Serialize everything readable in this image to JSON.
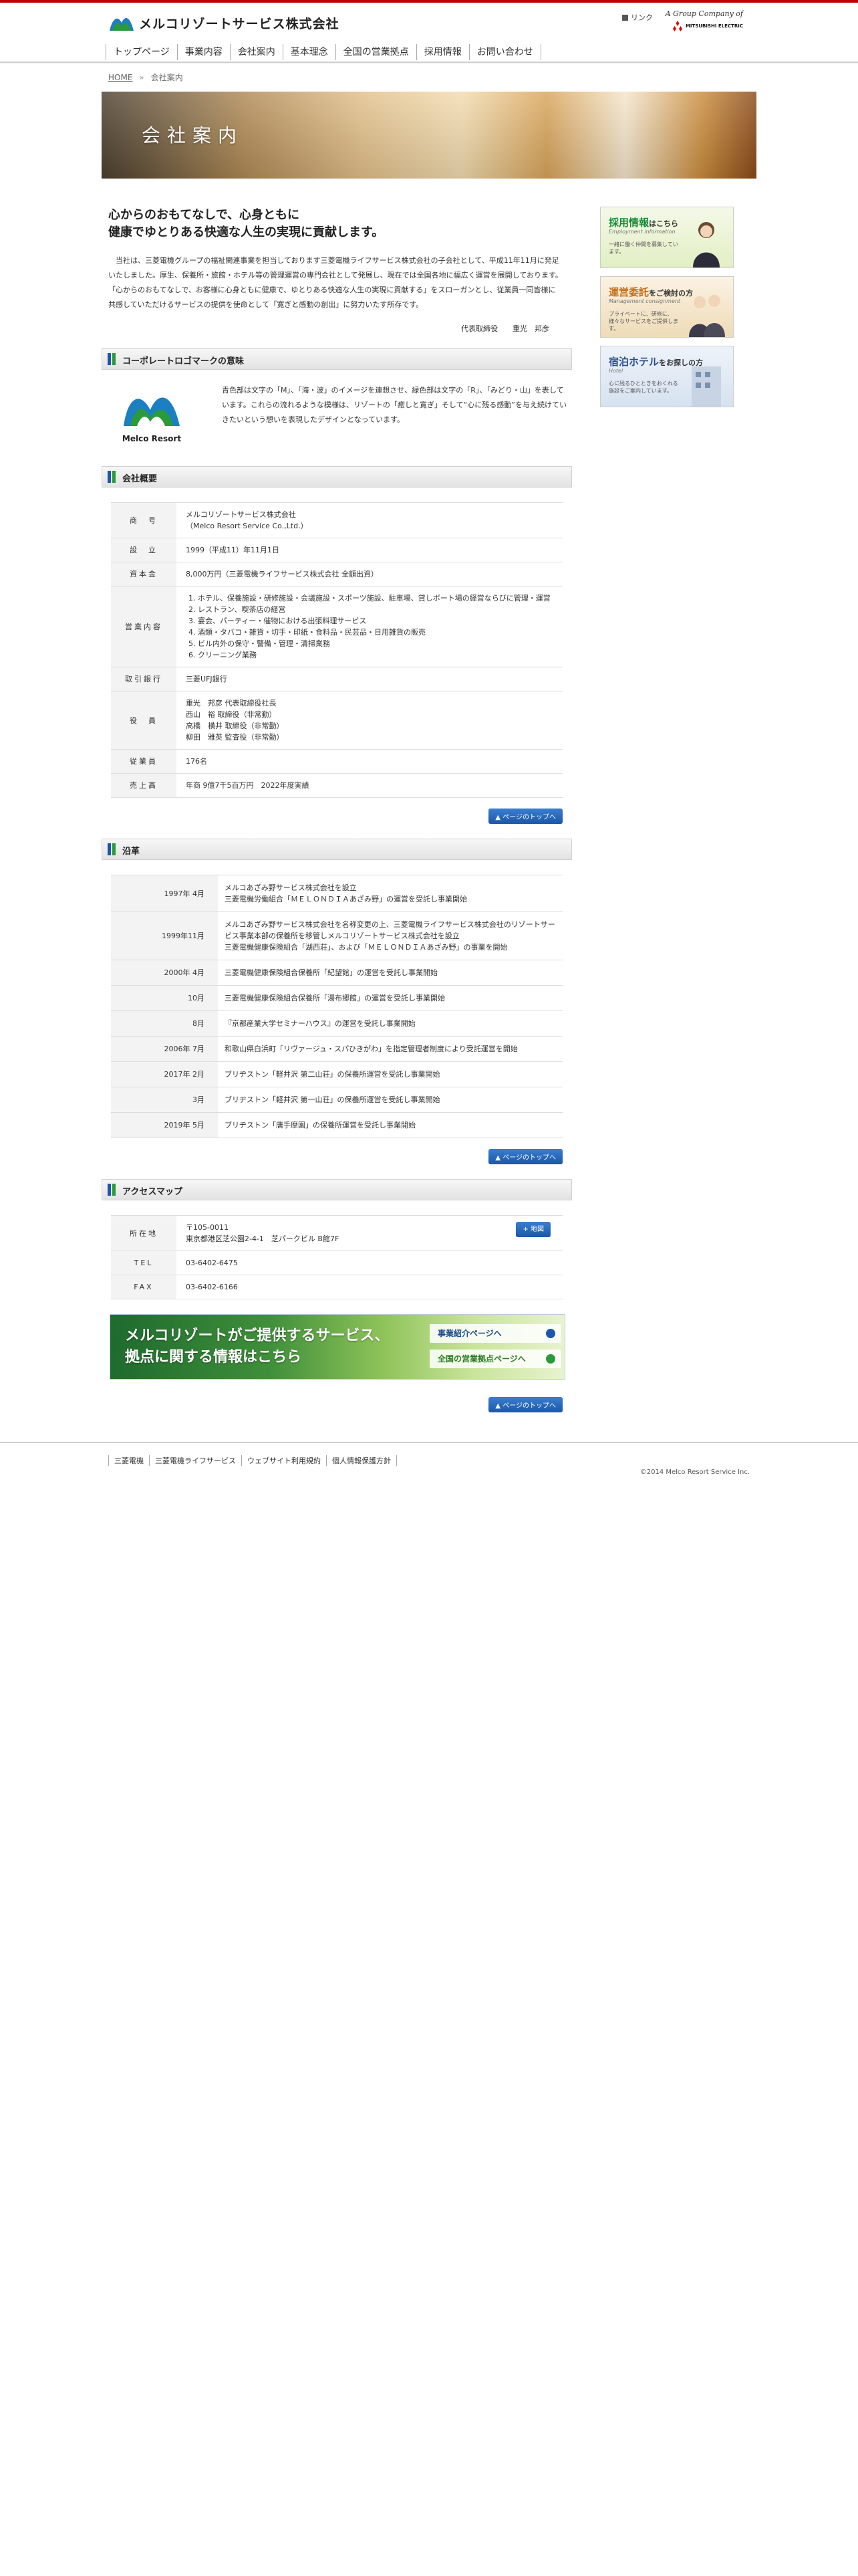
{
  "header": {
    "company_name": "メルコリゾートサービス株式会社",
    "link_label": "リンク",
    "group_label": "A Group Company of",
    "group_brand": "MITSUBISHI ELECTRIC"
  },
  "nav": [
    "トップページ",
    "事業内容",
    "会社案内",
    "基本理念",
    "全国の営業拠点",
    "採用情報",
    "お問い合わせ"
  ],
  "breadcrumb": {
    "home": "HOME",
    "sep": "»",
    "current": "会社案内"
  },
  "hero": {
    "title": "会社案内"
  },
  "intro": {
    "lead_line1": "心からのおもてなしで、心身ともに",
    "lead_line2": "健康でゆとりある快適な人生の実現に貢献します。",
    "body": "当社は、三菱電機グループの福祉関連事業を担当しております三菱電機ライフサービス株式会社の子会社として、平成11年11月に発足いたしました。厚生、保養所・旅館・ホテル等の管理運営の専門会社として発展し、現在では全国各地に幅広く運営を展開しております。「心からのおもてなしで、お客様に心身ともに健康で、ゆとりある快適な人生の実現に貢献する」をスローガンとし、従業員一同皆様に共感していただけるサービスの提供を使命として「寛ぎと感動の創出」に努力いたす所存です。",
    "sign": "代表取締役　　重光　邦彦"
  },
  "corporate": {
    "heading": "コーポレートロゴマークの意味",
    "logo_caption": "Melco Resort",
    "text": "青色部は文字の「M」、「海・波」のイメージを連想させ、緑色部は文字の「R」、「みどり・山」を表しています。これらの流れるような模様は、リゾートの「癒しと寛ぎ」そして“心に残る感動”を与え続けていきたいという想いを表現したデザインとなっています。"
  },
  "overview": {
    "heading": "会社概要",
    "rows": [
      {
        "key": "商　号",
        "lines": [
          "メルコリゾートサービス株式会社",
          "（Melco Resort Service Co.,Ltd.）"
        ]
      },
      {
        "key": "設　立",
        "lines": [
          "1999（平成11）年11月1日"
        ]
      },
      {
        "key": "資本金",
        "lines": [
          "8,000万円（三菱電機ライフサービス株式会社 全額出資）"
        ]
      },
      {
        "key": "営業内容",
        "list": [
          "ホテル、保養施設・研修施設・会議施設・スポーツ施設、駐車場、貸しボート場の経営ならびに管理・運営",
          "レストラン、喫茶店の経営",
          "宴会、パーティー・催物における出張料理サービス",
          "酒類・タバコ・雑貨・切手・印紙・食料品・民芸品・日用雑貨の販売",
          "ビル内外の保守・警備・管理・清掃業務",
          "クリーニング業務"
        ]
      },
      {
        "key": "取引銀行",
        "lines": [
          "三菱UFJ銀行"
        ]
      },
      {
        "key": "役　員",
        "lines": [
          "重光　邦彦 代表取締役社長",
          "西山　裕 取締役（非常勤）",
          "高橋　横井 取締役（非常勤）",
          "柳田　雅英 監査役（非常勤）"
        ]
      },
      {
        "key": "従業員",
        "lines": [
          "176名"
        ]
      },
      {
        "key": "売上高",
        "lines": [
          "年商 9億7千5百万円　2022年度実績"
        ]
      }
    ]
  },
  "page_top_label": "ページのトップへ",
  "history": {
    "heading": "沿革",
    "rows": [
      {
        "date": "1997年 4月",
        "text": "メルコあざみ野サービス株式会社を設立\n三菱電機労働組合「ＭＥＬＯＮＤＩＡあざみ野」の運営を受託し事業開始"
      },
      {
        "date": "1999年11月",
        "text": "メルコあざみ野サービス株式会社を名称変更の上、三菱電機ライフサービス株式会社のリゾートサービス事業本部の保養所を移管しメルコリゾートサービス株式会社を設立\n三菱電機健康保険組合「湖西荘」、および「ＭＥＬＯＮＤＩＡあざみ野」の事業を開始"
      },
      {
        "date": "2000年 4月",
        "text": "三菱電機健康保険組合保養所「紀望館」の運営を受託し事業開始"
      },
      {
        "date": "10月",
        "text": "三菱電機健康保険組合保養所「湯布郷館」の運営を受託し事業開始"
      },
      {
        "date": "8月",
        "text": "『京都産業大学セミナーハウス』の運営を受託し事業開始"
      },
      {
        "date": "2006年 7月",
        "text": "和歌山県白浜町「リヴァージュ・スパひきがわ」を指定管理者制度により受託運営を開始"
      },
      {
        "date": "2017年 2月",
        "text": "ブリヂストン「軽井沢 第二山荘」の保養所運営を受託し事業開始"
      },
      {
        "date": "3月",
        "text": "ブリヂストン「軽井沢 第一山荘」の保養所運営を受託し事業開始"
      },
      {
        "date": "2019年 5月",
        "text": "ブリヂストン「唐手摩園」の保養所運営を受託し事業開始"
      }
    ]
  },
  "access": {
    "heading": "アクセスマップ",
    "address_key": "所在地",
    "postal": "〒105-0011",
    "address": "東京都港区芝公園2-4-1　芝パークビル B館7F",
    "map_button": "地図",
    "tel_key": "TEL",
    "tel": "03-6402-6475",
    "fax_key": "FAX",
    "fax": "03-6402-6166"
  },
  "service_banner": {
    "title_line1": "メルコリゾートがご提供するサービス、",
    "title_line2": "拠点に関する情報はこちら",
    "link1": "事業紹介ページへ",
    "link2": "全国の営業拠点ページへ"
  },
  "sidebar": [
    {
      "title": "採用情報",
      "suffix": "はこちら",
      "sub": "Employment information",
      "desc": "一緒に働く仲間を募集しています。"
    },
    {
      "title": "運営委託",
      "suffix": "をご検討の方",
      "sub": "Management consignment",
      "desc": "プライベートに、研修に、様々なサービスをご提供します。"
    },
    {
      "title": "宿泊ホテル",
      "suffix": "をお探しの方",
      "sub": "Hotel",
      "desc": "心に残るひとときをおくれる施設をご案内しています。"
    }
  ],
  "footer": {
    "links": [
      "三菱電機",
      "三菱電機ライフサービス",
      "ウェブサイト利用規約",
      "個人情報保護方針"
    ],
    "copyright": "©2014 Melco Resort Service Inc."
  },
  "colors": {
    "accent_red": "#c00000",
    "brand_blue": "#1c57a8",
    "brand_green": "#2a9a3a"
  }
}
